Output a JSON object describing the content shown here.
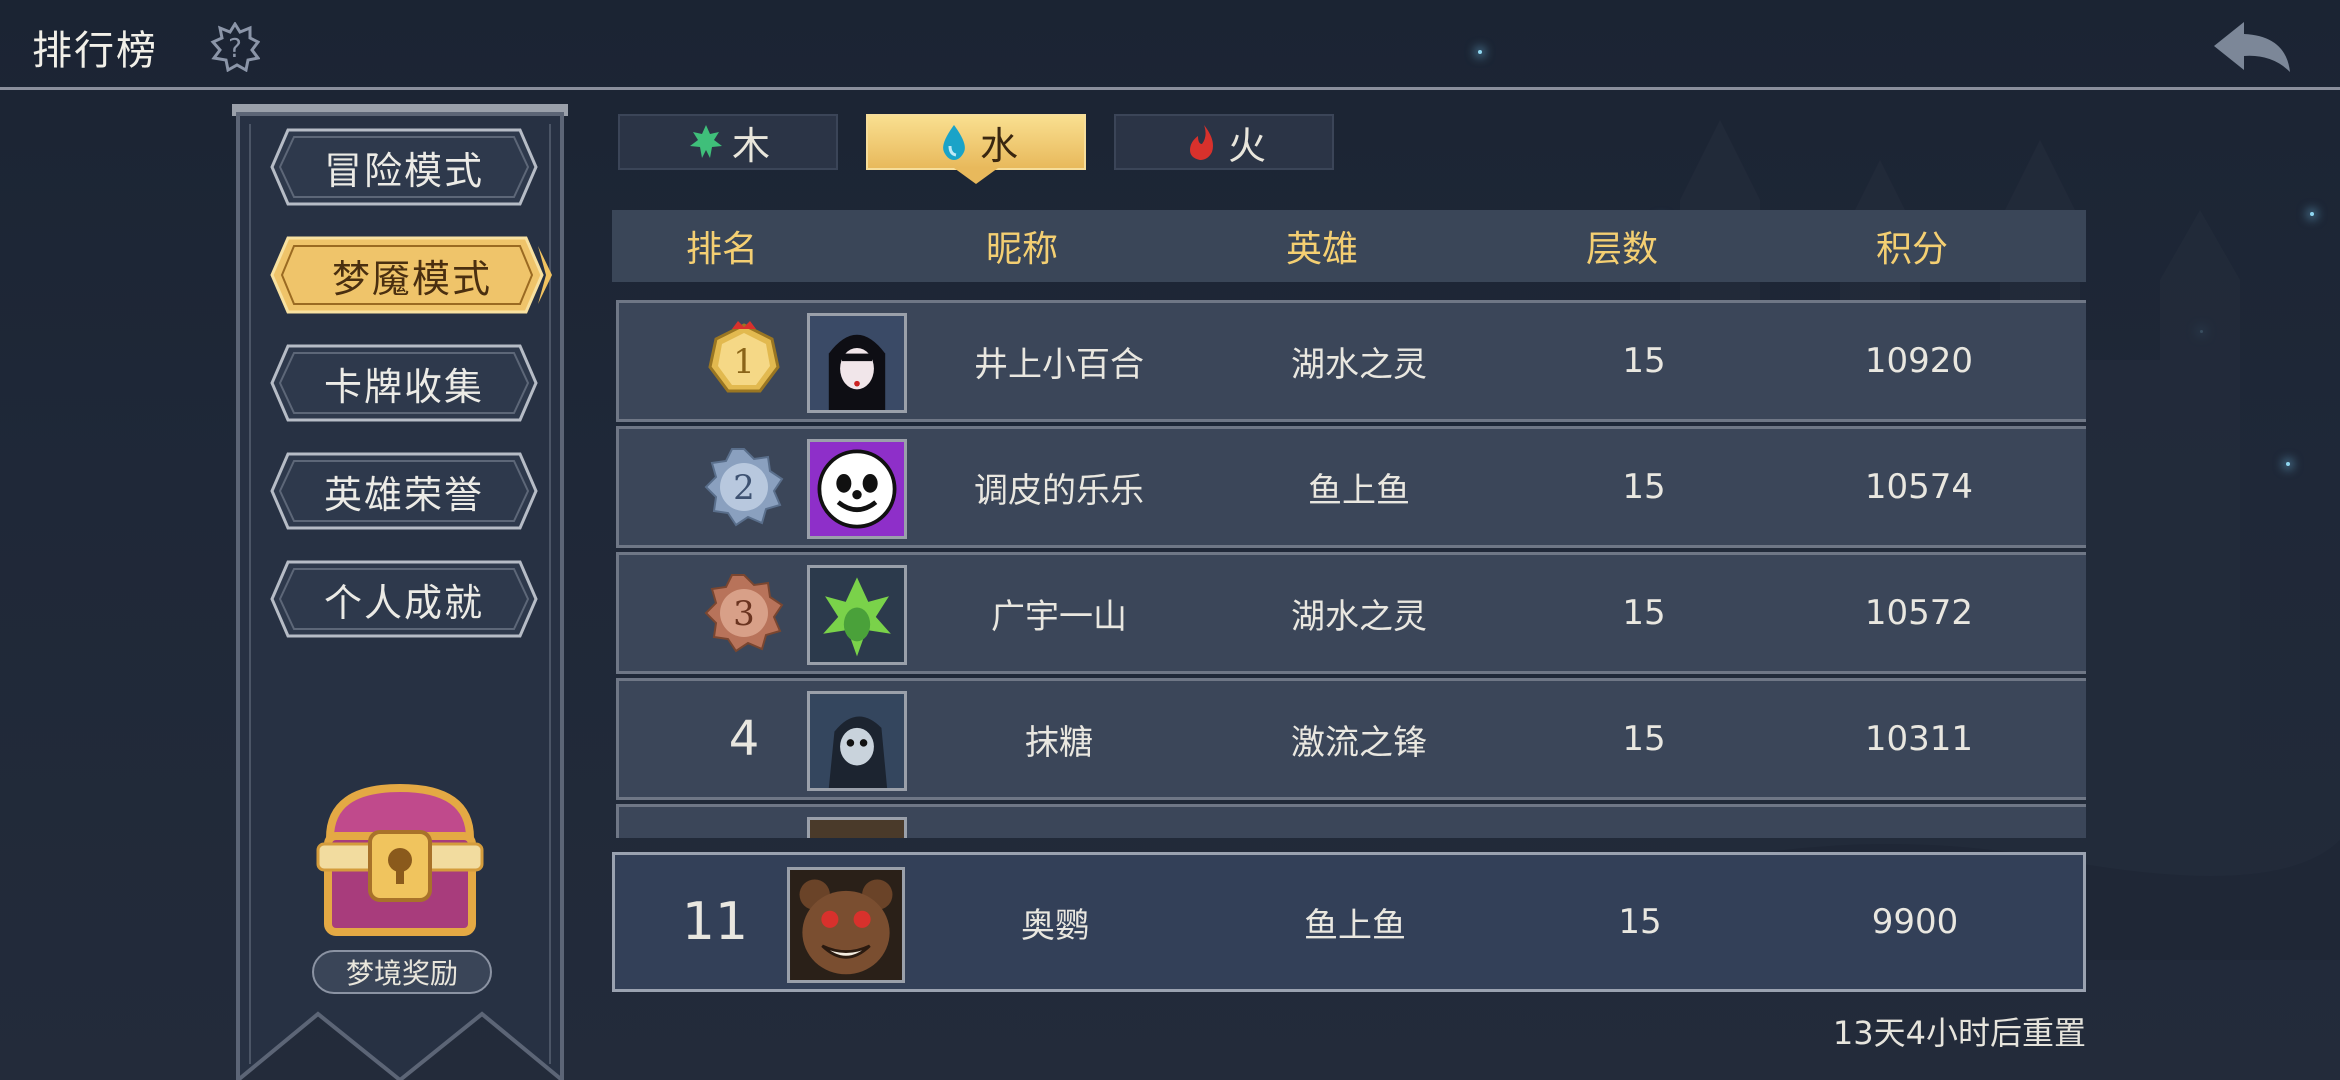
{
  "header": {
    "title": "排行榜"
  },
  "menu": [
    {
      "label": "冒险模式",
      "active": false
    },
    {
      "label": "梦魇模式",
      "active": true
    },
    {
      "label": "卡牌收集",
      "active": false
    },
    {
      "label": "英雄荣誉",
      "active": false
    },
    {
      "label": "个人成就",
      "active": false
    }
  ],
  "reward": {
    "label": "梦境奖励"
  },
  "tabs": [
    {
      "label": "木",
      "icon": "leaf-icon",
      "color": "#3fbf7a",
      "active": false
    },
    {
      "label": "水",
      "icon": "water-drop-icon",
      "color": "#1aa3c8",
      "active": true
    },
    {
      "label": "火",
      "icon": "fire-icon",
      "color": "#d8312c",
      "active": false
    }
  ],
  "table": {
    "headers": {
      "rank": "排名",
      "nickname": "昵称",
      "hero": "英雄",
      "floor": "层数",
      "score": "积分"
    },
    "rows": [
      {
        "rank": "1",
        "nickname": "井上小百合",
        "hero": "湖水之灵",
        "floor": "15",
        "score": "10920"
      },
      {
        "rank": "2",
        "nickname": "调皮的乐乐",
        "hero": "鱼上鱼",
        "floor": "15",
        "score": "10574"
      },
      {
        "rank": "3",
        "nickname": "广宇一山",
        "hero": "湖水之灵",
        "floor": "15",
        "score": "10572"
      },
      {
        "rank": "4",
        "nickname": "抹糖",
        "hero": "激流之锋",
        "floor": "15",
        "score": "10311"
      }
    ],
    "me": {
      "rank": "11",
      "nickname": "奥鹦",
      "hero": "鱼上鱼",
      "floor": "15",
      "score": "9900"
    }
  },
  "reset_text": "13天4小时后重置",
  "colors": {
    "gold": "#f4cf72",
    "gold_medal": "#e2b94f",
    "silver_medal": "#8aa0bf",
    "bronze_medal": "#b8735a"
  }
}
